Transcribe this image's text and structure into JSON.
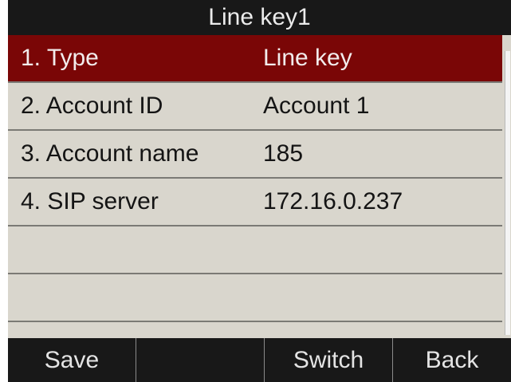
{
  "header": {
    "title": "Line key1"
  },
  "settings": {
    "items": [
      {
        "label": "1. Type",
        "value": "Line key",
        "selected": true
      },
      {
        "label": "2. Account ID",
        "value": "Account 1",
        "selected": false
      },
      {
        "label": "3. Account name",
        "value": "185",
        "selected": false
      },
      {
        "label": "4. SIP server",
        "value": "172.16.0.237",
        "selected": false
      }
    ]
  },
  "softkeys": {
    "save": "Save",
    "empty": "",
    "switch": "Switch",
    "back": "Back"
  },
  "colors": {
    "selected_row": "#7a0606",
    "title_bar": "#181818",
    "list_background": "#d9d6cd"
  }
}
